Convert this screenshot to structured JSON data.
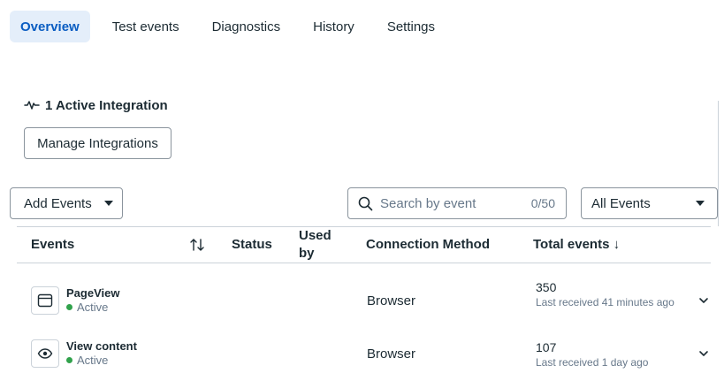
{
  "tabs": [
    {
      "label": "Overview",
      "active": true
    },
    {
      "label": "Test events",
      "active": false
    },
    {
      "label": "Diagnostics",
      "active": false
    },
    {
      "label": "History",
      "active": false
    },
    {
      "label": "Settings",
      "active": false
    }
  ],
  "integration": {
    "icon": "pulse-icon",
    "title": "1 Active Integration",
    "manage_label": "Manage Integrations"
  },
  "toolbar": {
    "add_events_label": "Add Events",
    "search_placeholder": "Search by event",
    "search_value": "",
    "search_counter": "0/50",
    "filter_selected": "All Events"
  },
  "table": {
    "columns": {
      "events": "Events",
      "status": "Status",
      "used_by_1": "Used",
      "used_by_2": "by",
      "connection_method": "Connection Method",
      "total_events": "Total events ↓"
    },
    "rows": [
      {
        "icon": "browser-window-icon",
        "name": "PageView",
        "status": "Active",
        "method": "Browser",
        "total": "350",
        "received": "Last received 41 minutes ago"
      },
      {
        "icon": "eye-icon",
        "name": "View content",
        "status": "Active",
        "method": "Browser",
        "total": "107",
        "received": "Last received 1 day ago"
      }
    ]
  },
  "colors": {
    "accent": "#0a5dc2",
    "active_tab_bg": "#e4eefa",
    "status_green": "#31a24c",
    "border": "#cbd2d9"
  }
}
